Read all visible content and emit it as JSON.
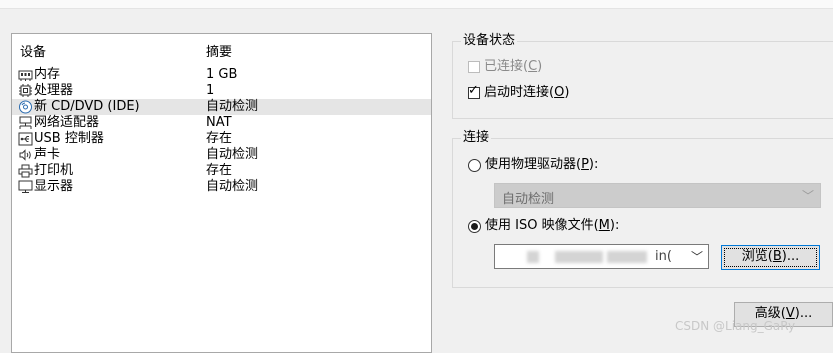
{
  "device_list": {
    "header": {
      "device": "设备",
      "summary": "摘要"
    },
    "rows": [
      {
        "icon": "memory-icon",
        "name": "内存",
        "summary": "1 GB",
        "selected": false
      },
      {
        "icon": "processor-icon",
        "name": "处理器",
        "summary": "1",
        "selected": false
      },
      {
        "icon": "cd-dvd-icon",
        "name": "新 CD/DVD (IDE)",
        "summary": "自动检测",
        "selected": true
      },
      {
        "icon": "network-adapter-icon",
        "name": "网络适配器",
        "summary": "NAT",
        "selected": false
      },
      {
        "icon": "usb-icon",
        "name": "USB 控制器",
        "summary": "存在",
        "selected": false
      },
      {
        "icon": "sound-card-icon",
        "name": "声卡",
        "summary": "自动检测",
        "selected": false
      },
      {
        "icon": "printer-icon",
        "name": "打印机",
        "summary": "存在",
        "selected": false
      },
      {
        "icon": "display-icon",
        "name": "显示器",
        "summary": "自动检测",
        "selected": false
      }
    ]
  },
  "device_status": {
    "legend": "设备状态",
    "connected": {
      "label": "已连接(",
      "key": "C",
      "suffix": ")",
      "checked": false,
      "enabled": false
    },
    "connect_at_power_on": {
      "label": "启动时连接(",
      "key": "O",
      "suffix": ")",
      "checked": true,
      "enabled": true
    }
  },
  "connection": {
    "legend": "连接",
    "use_physical": {
      "label": "使用物理驱动器(",
      "key": "P",
      "suffix": "):",
      "selected": false
    },
    "physical_value": "自动检测",
    "use_iso": {
      "label": "使用 ISO 映像文件(",
      "key": "M",
      "suffix": "):",
      "selected": true
    },
    "iso_value": "in("
  },
  "buttons": {
    "browse": {
      "label": "浏览(",
      "key": "B",
      "suffix": ")..."
    },
    "advanced": {
      "label": "高级(",
      "key": "V",
      "suffix": ")..."
    }
  },
  "watermark": "CSDN @Liang_GaRy"
}
